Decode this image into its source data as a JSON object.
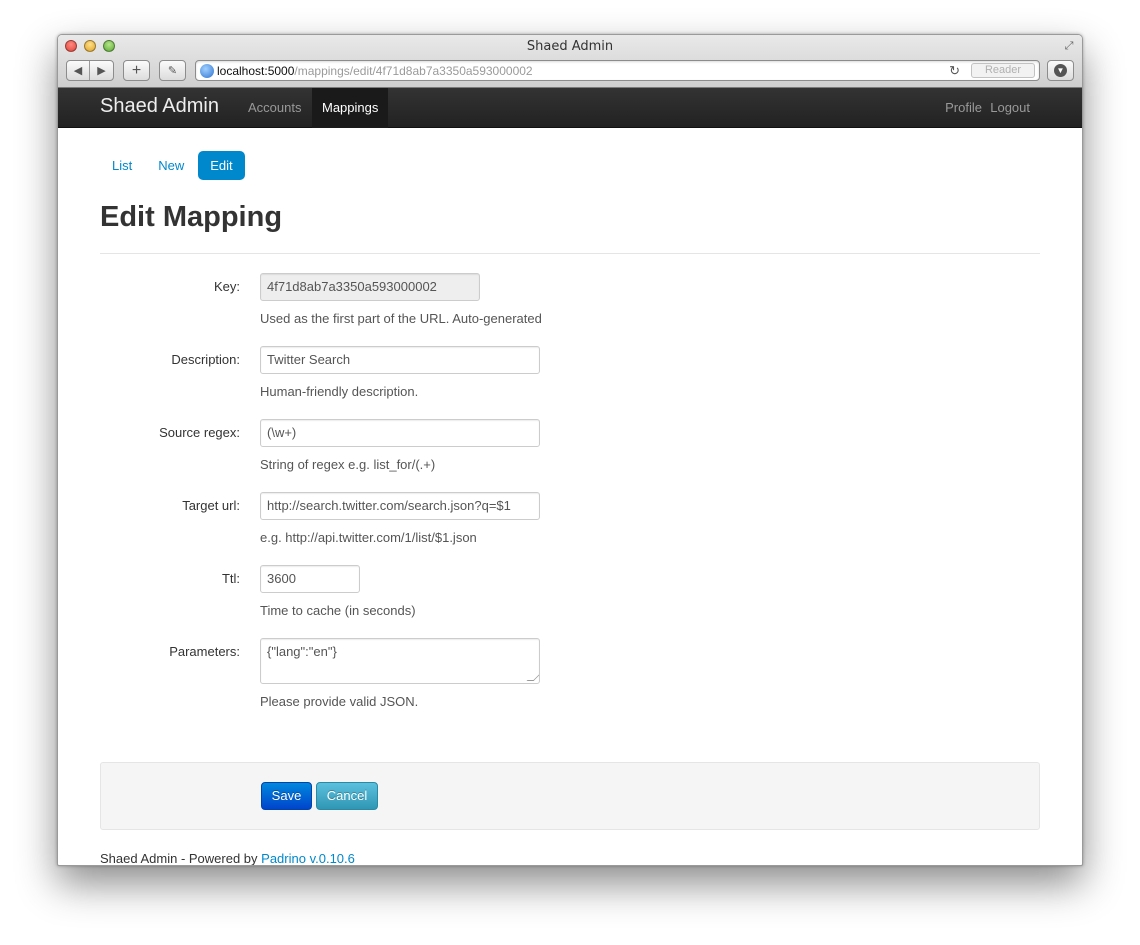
{
  "window": {
    "title": "Shaed Admin"
  },
  "toolbar": {
    "url_host": "localhost:5000",
    "url_path": "/mappings/edit/4f71d8ab7a3350a593000002",
    "reader_label": "Reader",
    "icons": {
      "back": "back-arrow-icon",
      "forward": "forward-arrow-icon",
      "add": "plus-icon",
      "reload": "reload-icon",
      "download": "download-icon"
    }
  },
  "navbar": {
    "brand": "Shaed Admin",
    "items": [
      {
        "label": "Accounts",
        "active": false
      },
      {
        "label": "Mappings",
        "active": true
      }
    ],
    "right_items": [
      {
        "label": "Profile"
      },
      {
        "label": "Logout"
      }
    ]
  },
  "subnav": {
    "pills": [
      {
        "label": "List",
        "active": false
      },
      {
        "label": "New",
        "active": false
      },
      {
        "label": "Edit",
        "active": true
      }
    ]
  },
  "page": {
    "title": "Edit Mapping"
  },
  "form": {
    "fields": [
      {
        "label": "Key:",
        "value": "4f71d8ab7a3350a593000002",
        "help": "Used as the first part of the URL. Auto-generated",
        "disabled": true
      },
      {
        "label": "Description:",
        "value": "Twitter Search",
        "help": "Human-friendly description."
      },
      {
        "label": "Source regex:",
        "value": "(\\w+)",
        "help": "String of regex e.g. list_for/(.+)"
      },
      {
        "label": "Target url:",
        "value": "http://search.twitter.com/search.json?q=$1",
        "help": "e.g. http://api.twitter.com/1/list/$1.json"
      },
      {
        "label": "Ttl:",
        "value": "3600",
        "help": "Time to cache (in seconds)"
      },
      {
        "label": "Parameters:",
        "value": "{\"lang\":\"en\"}",
        "help": "Please provide valid JSON."
      }
    ],
    "save_label": "Save",
    "cancel_label": "Cancel"
  },
  "footer": {
    "text": "Shaed Admin - Powered by ",
    "link_text": "Padrino v.0.10.6"
  },
  "colors": {
    "link": "#0088cc",
    "navbar": "#222222",
    "save_button": "#0055cc",
    "cancel_button": "#49afcd"
  }
}
